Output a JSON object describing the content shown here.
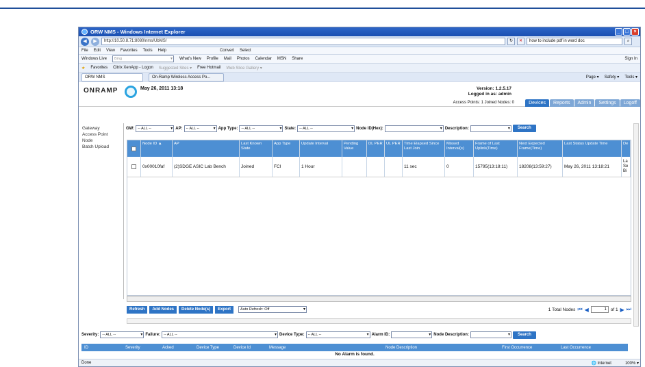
{
  "window": {
    "title": "ORW NMS - Windows Internet Explorer"
  },
  "browser": {
    "url": "http://10.50.8.71:8080/nms/UbMS/",
    "search_value": "how to include pdf in word doc",
    "menu": [
      "File",
      "Edit",
      "View",
      "Favorites",
      "Tools",
      "Help"
    ],
    "convert": "Convert",
    "select": "Select",
    "toolbar2": {
      "live": "Windows Live",
      "search_placeholder": "Bing",
      "links": [
        "What's New",
        "Profile",
        "Mail",
        "Photos",
        "Calendar",
        "MSN",
        "Share"
      ],
      "signin": "Sign In"
    },
    "favorites": {
      "label": "Favorites",
      "items": [
        "Citrix XenApp - Logon",
        "Suggested Sites ▾",
        "Free Hotmail",
        "Web Slice Gallery ▾"
      ]
    },
    "tabs": [
      "ORW NMS",
      "On-Ramp Wireless Access Po..."
    ],
    "cmdbar": [
      "Page ▾",
      "Safety ▾",
      "Tools ▾"
    ]
  },
  "app": {
    "logo": "ONRAMP",
    "datetime": "May 26, 2011 13:18",
    "version": "Version: 1.2.5.17",
    "logged_in": "Logged in as: admin",
    "access_points": "Access Points: 1 Joined Nodes: 0",
    "tabs": [
      "Devices",
      "Reports",
      "Admin",
      "Settings",
      "Logoff"
    ]
  },
  "leftnav": [
    "Gateway",
    "Access Point",
    "Node",
    "Batch Upload"
  ],
  "filters": {
    "gw_label": "GW:",
    "gw_value": "-- ALL --",
    "ap_label": "AP:",
    "ap_value": "-- ALL --",
    "apptype_label": "App Type:",
    "apptype_value": "-- ALL --",
    "state_label": "State:",
    "state_value": "-- ALL --",
    "nodeid_label": "Node ID(Hex):",
    "desc_label": "Description:",
    "search": "Search"
  },
  "grid": {
    "headers": [
      "Node ID ▲",
      "AP",
      "Last Known State",
      "App Type",
      "Update Interval",
      "Pending Value",
      "DL PER",
      "UL PER",
      "Time Elapsed Since Last Join",
      "Missed Interval(s)",
      "Frame of Last Uplink(Time)",
      "Next Expected Frame(Time)",
      "Last Status Update Time",
      "De"
    ],
    "row": [
      "0x00010faf",
      "(2)SDGE ASIC Lab Bench",
      "Joined",
      "FCI",
      "1 Hour",
      "",
      "",
      "",
      "11 sec",
      "0",
      "15795(13:18:11)",
      "18208(13:59:27)",
      "May 26, 2011 13:18:21",
      "La Se Bi"
    ]
  },
  "actions": {
    "refresh": "Refresh",
    "add": "Add Nodes",
    "delete": "Delete Node(s)",
    "export": "Export",
    "autorefresh": "Auto Refresh: Off",
    "total": "1 Total Nodes",
    "page": "1",
    "of": "of 1"
  },
  "alarms": {
    "severity_label": "Severity:",
    "severity_value": "-- ALL --",
    "failure_label": "Failure:",
    "failure_value": "-- ALL --",
    "devtype_label": "Device Type:",
    "devtype_value": "-- ALL --",
    "alarmid_label": "Alarm ID:",
    "nodedesc_label": "Node Description:",
    "search": "Search",
    "headers": [
      "ID",
      "Severity",
      "Acked",
      "Device Type",
      "Device Id",
      "Message",
      "Node Description",
      "First Occurrence",
      "Last Occurrence"
    ],
    "empty": "No Alarm is found."
  },
  "status": {
    "left": "Done",
    "zone": "Internet",
    "zoom": "100% ▾"
  }
}
